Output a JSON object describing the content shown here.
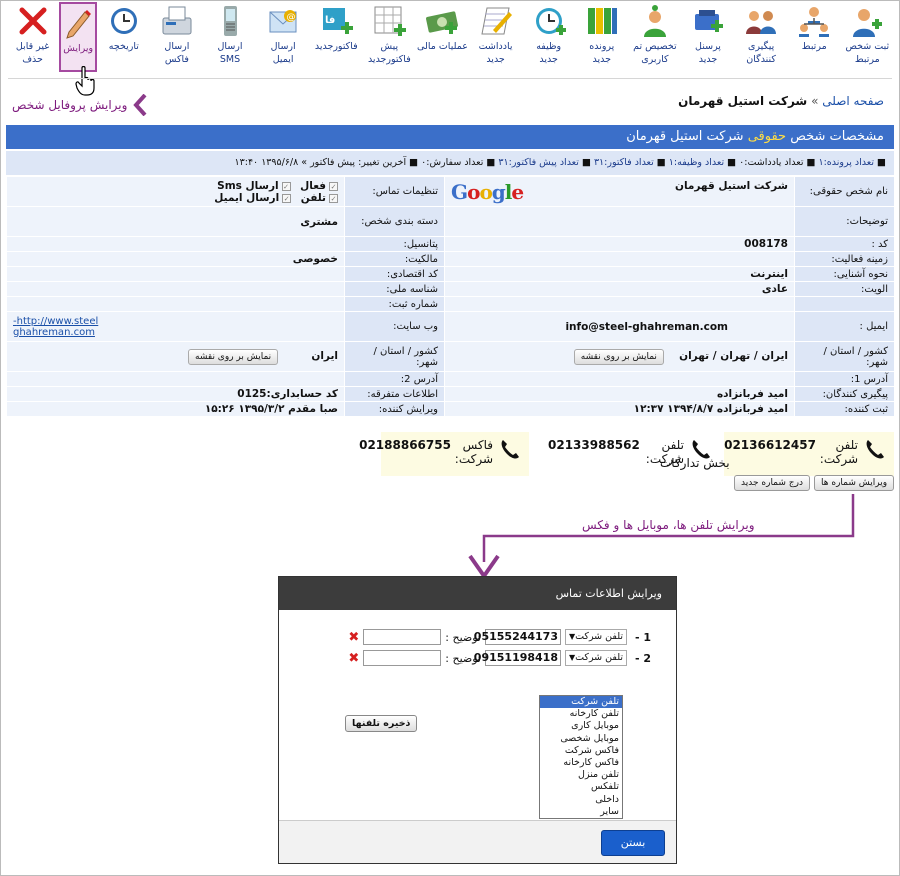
{
  "toolbar": [
    {
      "label": "ثبت شخص\nمرتبط",
      "icon": "add-person-icon"
    },
    {
      "label": "مرتبط",
      "icon": "org-chart-icon"
    },
    {
      "label": "پیگیری\nکنندگان",
      "icon": "people-group-icon"
    },
    {
      "label": "پرسنل\nجدید",
      "icon": "add-staff-icon"
    },
    {
      "label": "تخصیص تم\nکاربری",
      "icon": "user-theme-icon"
    },
    {
      "label": "پرونده\nجدید",
      "icon": "binders-icon"
    },
    {
      "label": "وظیفه\nجدید",
      "icon": "task-clock-icon"
    },
    {
      "label": "یادداشت\nجدید",
      "icon": "note-pencil-icon"
    },
    {
      "label": "عملیات مالی",
      "icon": "money-icon"
    },
    {
      "label": "پیش\nفاکتورجدید",
      "icon": "pre-invoice-icon"
    },
    {
      "label": "فاکتورجدید",
      "icon": "invoice-icon"
    },
    {
      "label": "ارسال\nایمیل",
      "icon": "email-icon"
    },
    {
      "label": "ارسال\nSMS",
      "icon": "sms-phone-icon"
    },
    {
      "label": "ارسال\nفاکس",
      "icon": "fax-icon"
    },
    {
      "label": "تاریخچه",
      "icon": "history-icon"
    },
    {
      "label": "ویرایش",
      "icon": "edit-pencil-icon",
      "active": true
    },
    {
      "label": "غیر قابل\nحذف",
      "icon": "red-x-icon"
    }
  ],
  "breadcrumb": {
    "home": "صفحه اصلی",
    "sep": "»",
    "current": "شرکت استیل قهرمان"
  },
  "edit_profile_link": "ویرایش پروفایل شخص",
  "title": {
    "prefix": "مشخصات شخص",
    "highlight": "حقوقی",
    "name": "شرکت استیل قهرمان"
  },
  "stats": {
    "files": "تعداد پرونده:۱",
    "notes": "تعداد یادداشت:۰",
    "tasks": "تعداد وظیفه:۱",
    "invoices": "تعداد فاکتور:۳۱",
    "preinvoices": "تعداد پیش فاکتور:۳۱",
    "orders": "تعداد سفارش:۰",
    "last_change": "آخرین تغییر: پیش فاکتور » ۱۳۹۵/۶/۸ ۱۳:۴۰"
  },
  "info": {
    "name_label": "نام شخص حقوقی:",
    "name_value": "شرکت استیل قهرمان",
    "google": "Google",
    "contact_settings_label": "تنظیمات تماس:",
    "active": "فعال",
    "send_sms": "ارسال Sms",
    "phone": "تلفن",
    "send_email": "ارسال ایمیل",
    "desc_label": "توضیحات:",
    "category_label": "دسته بندی شخص:",
    "category_value": "مشتری",
    "code_label": "کد :",
    "code_value": "008178",
    "potential_label": "پتانسیل:",
    "activity_label": "زمینه فعالیت:",
    "ownership_label": "مالکیت:",
    "ownership_value": "خصوصی",
    "acquaint_label": "نحوه آشنایی:",
    "acquaint_value": "اینترنت",
    "econ_label": "کد اقتصادی:",
    "priority_label": "الویت:",
    "priority_value": "عادی",
    "national_label": "شناسه ملی:",
    "reg_label": "شماره ثبت:",
    "email_label": "ایمیل :",
    "email_value": "info@steel-ghahreman.com",
    "website_label": "وب سایت:",
    "website_line1": "http://www.steel-",
    "website_line2": "ghahreman.com",
    "loc_label": "کشور / استان / شهر:",
    "loc_value": "ایران / تهران / تهران",
    "map_btn": "نمایش بر روی نقشه",
    "loc2_label": "کشور / استان / شهر:",
    "loc2_value": "ایران",
    "addr1_label": "آدرس 1:",
    "addr2_label": "آدرس 2:",
    "followers_label": "پیگیری کنندگان:",
    "followers_value": "امید فربانزاده",
    "misc_label": "اطلاعات متفرقه:",
    "misc_value": "کد حسابداری:0125",
    "registrar_label": "ثبت کننده:",
    "registrar_value": "امید فربانزاده ۱۳۹۴/۸/۷ ۱۲:۳۷",
    "editor_label": "ویرایش کننده:",
    "editor_value": "صبا مقدم ۱۳۹۵/۳/۲ ۱۵:۲۶"
  },
  "phones": [
    {
      "label": "تلفن شرکت:",
      "number": "02136612457"
    },
    {
      "label": "تلفن شرکت:",
      "number": "02133988562"
    },
    {
      "label": "فاکس شرکت:",
      "number": "02188866755"
    }
  ],
  "phone_note": "بخش تدارکات",
  "buttons": {
    "edit_numbers": "ویرایش شماره ها",
    "add_number": "درج شماره جدید"
  },
  "annotation": "ویرایش تلفن ها، موبایل ها و فکس",
  "dialog": {
    "title": "ویرایش اطلاعات تماس",
    "rows": [
      {
        "num": "1 -",
        "type": "تلفن شرکت",
        "number": "05155244173",
        "desc_label": "توضیح :"
      },
      {
        "num": "2 -",
        "type": "تلفن شرکت",
        "number": "09151198418",
        "desc_label": "توضیح :"
      }
    ],
    "options": [
      "تلفن شرکت",
      "تلفن کارخانه",
      "موبایل کاری",
      "موبایل شخصی",
      "فاکس شرکت",
      "فاکس کارخانه",
      "تلفن منزل",
      "تلفکس",
      "داخلی",
      "سایر"
    ],
    "save": "ذخیره تلفنها",
    "close": "بستن"
  },
  "colors": {
    "accent": "#3b6fc9",
    "highlight": "#ffde44",
    "purple": "#7d1a7d",
    "label_bg": "#dde6f6"
  }
}
